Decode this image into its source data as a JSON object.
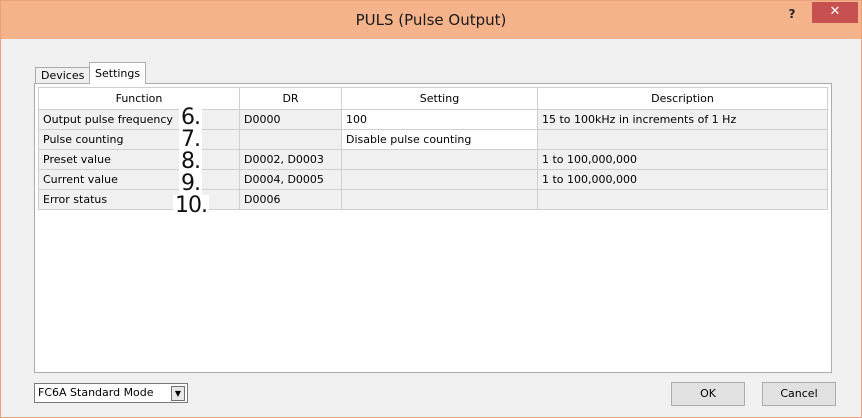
{
  "window": {
    "title": "PULS (Pulse Output)",
    "help_label": "?",
    "close_label": "✕"
  },
  "tabs": [
    {
      "label": "Devices"
    },
    {
      "label": "Settings"
    }
  ],
  "table": {
    "headers": [
      "Function",
      "DR",
      "Setting",
      "Description"
    ],
    "rows": [
      {
        "function": "Output pulse frequency",
        "dr": "D0000",
        "setting": "100",
        "description": "15 to 100kHz in increments of 1 Hz"
      },
      {
        "function": "Pulse counting",
        "dr": "",
        "setting": "Disable pulse counting",
        "description": ""
      },
      {
        "function": "Preset value",
        "dr": "D0002, D0003",
        "setting": "",
        "description": "1 to 100,000,000"
      },
      {
        "function": "Current value",
        "dr": "D0004, D0005",
        "setting": "",
        "description": "1 to 100,000,000"
      },
      {
        "function": "Error status",
        "dr": "D0006",
        "setting": "",
        "description": ""
      }
    ]
  },
  "callouts": [
    "6.",
    "7.",
    "8.",
    "9.",
    "10."
  ],
  "mode_select": {
    "value": "FC6A Standard Mode"
  },
  "buttons": {
    "ok": "OK",
    "cancel": "Cancel"
  }
}
